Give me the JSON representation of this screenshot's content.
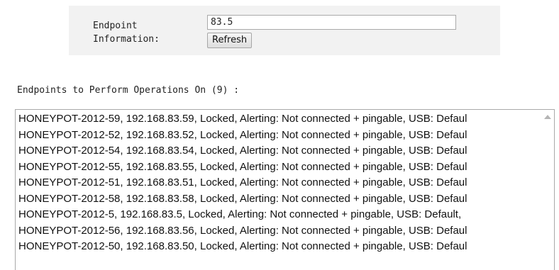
{
  "endpoint_info": {
    "label_line1": "Endpoint",
    "label_line2": "Information:",
    "input_value": "83.5",
    "refresh_label": "Refresh"
  },
  "operations": {
    "heading": "Endpoints to Perform Operations On (9) :",
    "items": [
      "HONEYPOT-2012-59, 192.168.83.59, Locked, Alerting: Not connected + pingable, USB: Defaul",
      "HONEYPOT-2012-52, 192.168.83.52, Locked, Alerting: Not connected + pingable, USB: Defaul",
      "HONEYPOT-2012-54, 192.168.83.54, Locked, Alerting: Not connected + pingable, USB: Defaul",
      "HONEYPOT-2012-55, 192.168.83.55, Locked, Alerting: Not connected + pingable, USB: Defaul",
      "HONEYPOT-2012-51, 192.168.83.51, Locked, Alerting: Not connected + pingable, USB: Defaul",
      "HONEYPOT-2012-58, 192.168.83.58, Locked, Alerting: Not connected + pingable, USB: Defaul",
      "HONEYPOT-2012-5, 192.168.83.5, Locked, Alerting: Not connected + pingable, USB: Default,",
      "HONEYPOT-2012-56, 192.168.83.56, Locked, Alerting: Not connected + pingable, USB: Defaul",
      "HONEYPOT-2012-50, 192.168.83.50, Locked, Alerting: Not connected + pingable, USB: Defaul"
    ]
  },
  "icons": {
    "scroll_up": "scroll-up-arrow-icon"
  }
}
